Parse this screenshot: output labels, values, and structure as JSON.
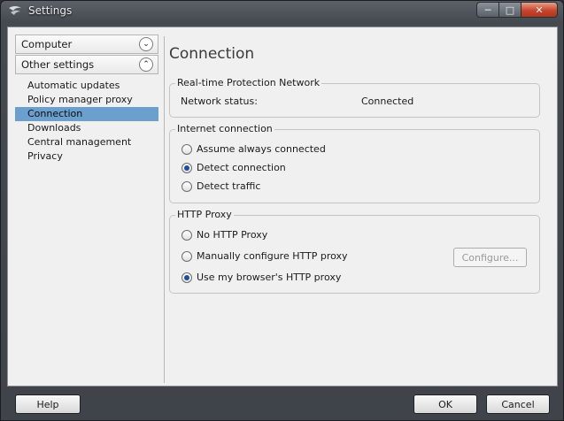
{
  "window": {
    "title": "Settings"
  },
  "sidebar": {
    "categories": [
      {
        "label": "Computer",
        "expanded": false
      },
      {
        "label": "Other settings",
        "expanded": true
      }
    ],
    "items": [
      {
        "label": "Automatic updates"
      },
      {
        "label": "Policy manager proxy"
      },
      {
        "label": "Connection",
        "selected": true
      },
      {
        "label": "Downloads"
      },
      {
        "label": "Central management"
      },
      {
        "label": "Privacy"
      }
    ]
  },
  "page": {
    "title": "Connection",
    "rtpn": {
      "label": "Real-time Protection Network",
      "status_key": "Network status:",
      "status_value": "Connected"
    },
    "internet": {
      "label": "Internet connection",
      "options": [
        {
          "label": "Assume always connected",
          "checked": false
        },
        {
          "label": "Detect connection",
          "checked": true
        },
        {
          "label": "Detect traffic",
          "checked": false
        }
      ]
    },
    "proxy": {
      "label": "HTTP Proxy",
      "options": [
        {
          "label": "No HTTP Proxy",
          "checked": false
        },
        {
          "label": "Manually configure HTTP proxy",
          "checked": false
        },
        {
          "label": "Use my browser's HTTP proxy",
          "checked": true
        }
      ],
      "configure_label": "Configure..."
    }
  },
  "footer": {
    "help": "Help",
    "ok": "OK",
    "cancel": "Cancel"
  },
  "colors": {
    "selection": "#6b9fcd",
    "close_button": "#c8452d",
    "frame": "#454a50"
  }
}
